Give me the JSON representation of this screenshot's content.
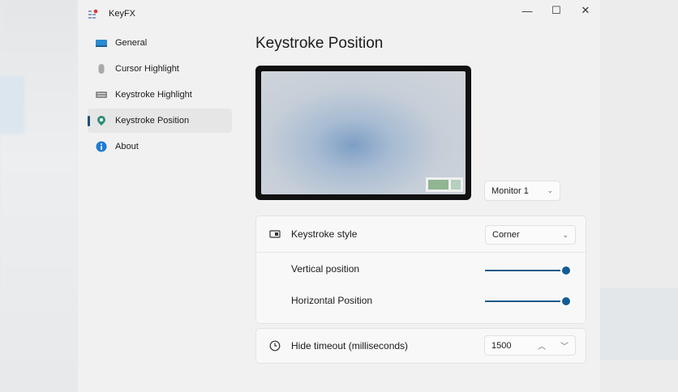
{
  "app": {
    "title": "KeyFX"
  },
  "window_controls": {
    "minimize": "—",
    "maximize": "☐",
    "close": "✕"
  },
  "nav": [
    {
      "label": "General",
      "icon": "monitor-icon"
    },
    {
      "label": "Cursor Highlight",
      "icon": "mouse-icon"
    },
    {
      "label": "Keystroke Highlight",
      "icon": "keyboard-icon"
    },
    {
      "label": "Keystroke Position",
      "icon": "location-pin-icon",
      "active": true
    },
    {
      "label": "About",
      "icon": "info-icon"
    }
  ],
  "page": {
    "title": "Keystroke Position"
  },
  "monitor": {
    "selected": "Monitor 1"
  },
  "style": {
    "label": "Keystroke style",
    "value": "Corner"
  },
  "vertical": {
    "label": "Vertical position",
    "value_percent": 100
  },
  "horizontal": {
    "label": "Horizontal Position",
    "value_percent": 100
  },
  "timeout": {
    "label": "Hide timeout (milliseconds)",
    "value": "1500"
  },
  "colors": {
    "accent": "#135c94"
  }
}
